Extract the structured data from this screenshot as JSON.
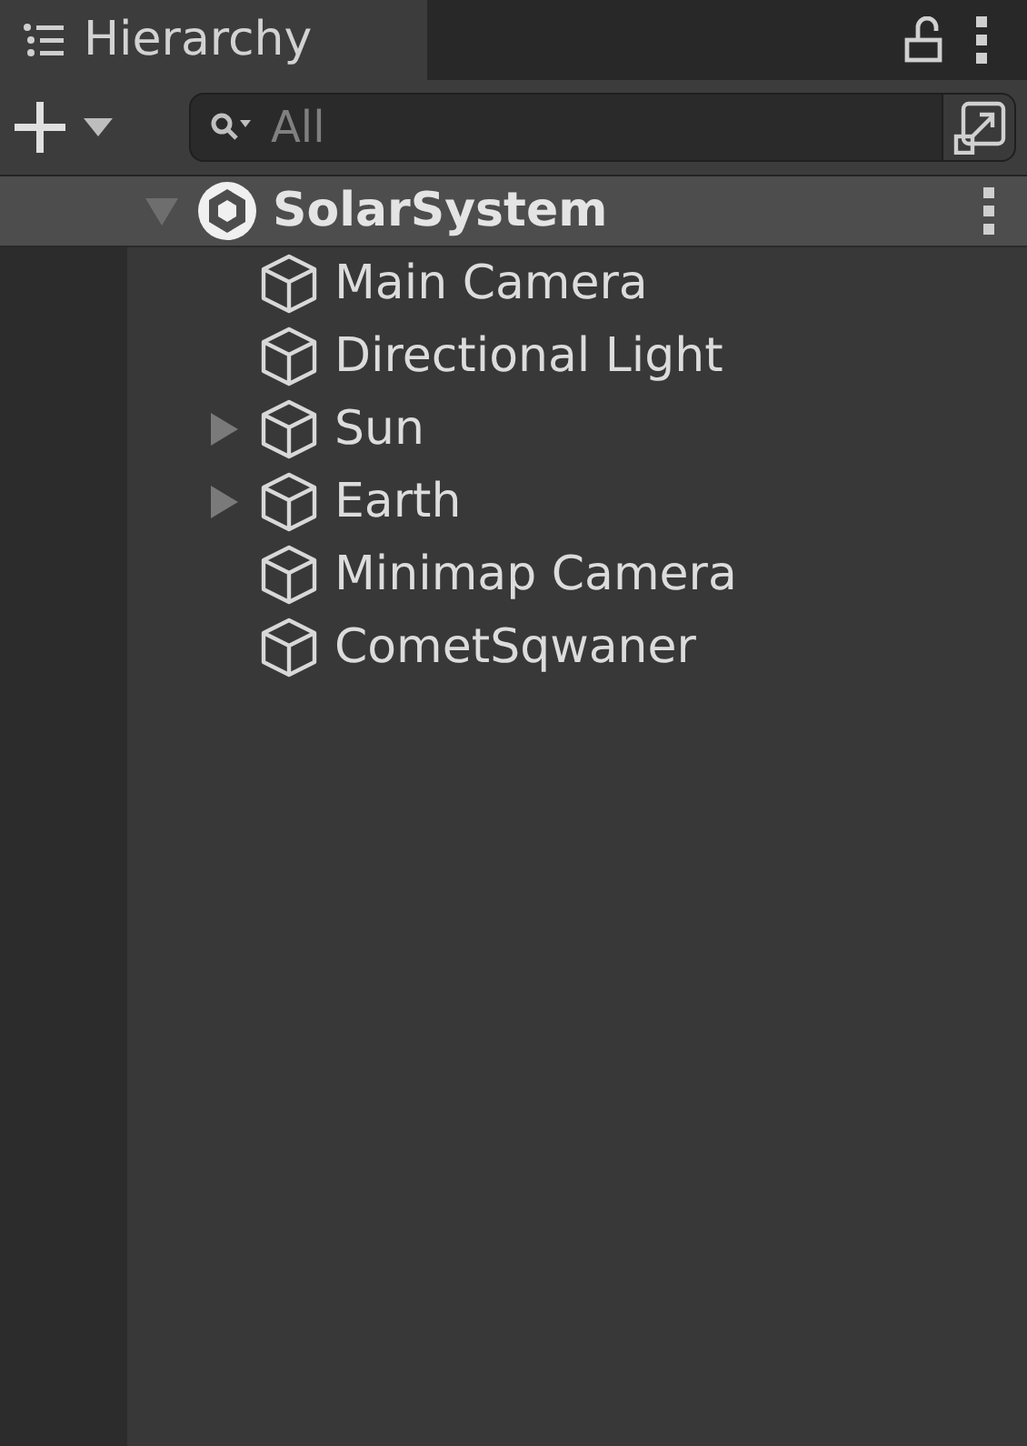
{
  "tab": {
    "title": "Hierarchy",
    "selected": true
  },
  "search": {
    "placeholder": "All"
  },
  "scene": {
    "name": "SolarSystem",
    "expanded": true,
    "children": [
      {
        "name": "Main Camera"
      },
      {
        "name": "Directional Light"
      },
      {
        "name": "Sun",
        "expanded": false
      },
      {
        "name": "Earth",
        "expanded": false
      },
      {
        "name": "Minimap Camera"
      },
      {
        "name": "CometSqwaner"
      }
    ]
  }
}
